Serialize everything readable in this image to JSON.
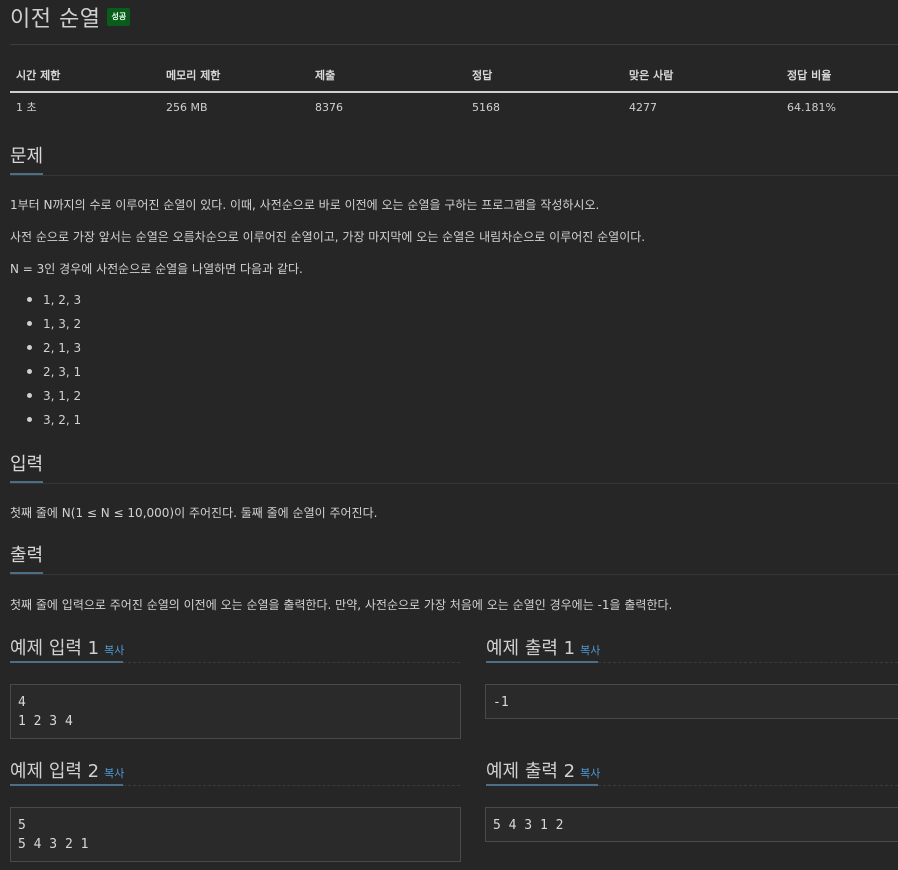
{
  "problem": {
    "title": "이전 순열",
    "badge": "성공"
  },
  "stats": {
    "headers": [
      "시간 제한",
      "메모리 제한",
      "제출",
      "정답",
      "맞은 사람",
      "정답 비율"
    ],
    "values": [
      "1 초",
      "256 MB",
      "8376",
      "5168",
      "4277",
      "64.181%"
    ]
  },
  "sections": {
    "problem_h": "문제",
    "problem_p1": "1부터 N까지의 수로 이루어진 순열이 있다. 이때, 사전순으로 바로 이전에 오는 순열을 구하는 프로그램을 작성하시오.",
    "problem_p2": "사전 순으로 가장 앞서는 순열은 오름차순으로 이루어진 순열이고, 가장 마지막에 오는 순열은 내림차순으로 이루어진 순열이다.",
    "problem_p3": "N = 3인 경우에 사전순으로 순열을 나열하면 다음과 같다.",
    "perms": [
      "1, 2, 3",
      "1, 3, 2",
      "2, 1, 3",
      "2, 3, 1",
      "3, 1, 2",
      "3, 2, 1"
    ],
    "input_h": "입력",
    "input_p": "첫째 줄에 N(1 ≤ N ≤ 10,000)이 주어진다. 둘째 줄에 순열이 주어진다.",
    "output_h": "출력",
    "output_p": "첫째 줄에 입력으로 주어진 순열의 이전에 오는 순열을 출력한다. 만약, 사전순으로 가장 처음에 오는 순열인 경우에는 -1을 출력한다."
  },
  "examples": {
    "copy_label": "복사",
    "in1_h": "예제 입력 1",
    "in1": "4\n1 2 3 4",
    "out1_h": "예제 출력 1",
    "out1": "-1",
    "in2_h": "예제 입력 2",
    "in2": "5\n5 4 3 2 1",
    "out2_h": "예제 출력 2",
    "out2": "5 4 3 1 2"
  }
}
